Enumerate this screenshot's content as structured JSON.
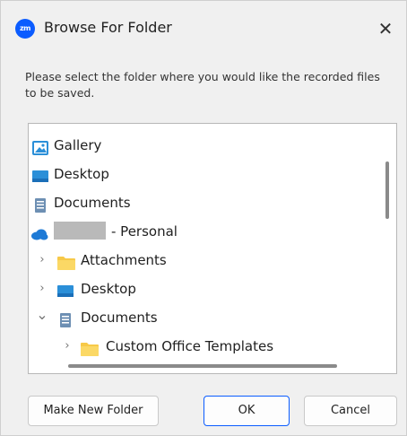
{
  "window": {
    "title": "Browse For Folder",
    "app_icon_text": "zm",
    "close_glyph": "✕"
  },
  "instruction": "Please select the folder where you would like the recorded files to be saved.",
  "tree": {
    "items": [
      {
        "label": "Gallery",
        "icon": "gallery-icon",
        "chevron": ""
      },
      {
        "label": "Desktop",
        "icon": "desktop-icon",
        "chevron": ""
      },
      {
        "label": "Documents",
        "icon": "documents-icon",
        "chevron": ""
      },
      {
        "label": "- Personal",
        "icon": "onedrive-cloud-icon",
        "chevron": "",
        "redacted_prefix": true
      },
      {
        "label": "Attachments",
        "icon": "folder-icon",
        "chevron": "›"
      },
      {
        "label": "Desktop",
        "icon": "desktop-icon",
        "chevron": "›"
      },
      {
        "label": "Documents",
        "icon": "documents-icon",
        "chevron": "⌄"
      },
      {
        "label": "Custom Office Templates",
        "icon": "folder-icon",
        "chevron": "›"
      }
    ]
  },
  "buttons": {
    "make_new_folder": "Make New Folder",
    "ok": "OK",
    "cancel": "Cancel"
  },
  "colors": {
    "accent": "#0b5cff",
    "folder_yellow": "#f7c948",
    "desktop_blue": "#2b8fd8",
    "cloud_blue": "#1e7ad6"
  }
}
